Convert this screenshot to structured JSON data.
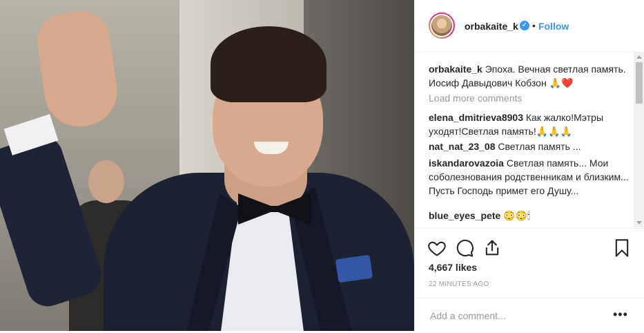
{
  "post": {
    "username": "orbakaite_k",
    "verified_icon": "verified-badge-icon",
    "separator": "•",
    "follow_label": "Follow"
  },
  "caption": {
    "username": "orbakaite_k",
    "text": "Эпоха. Вечная светлая память. Иосиф Давыдович Кобзон 🙏❤️"
  },
  "load_more": "Load more comments",
  "comments": [
    {
      "username": "elena_dmitrieva8903",
      "text": "Как жалко!Мэтры уходят!Светлая память!🙏🙏🙏"
    },
    {
      "username": "nat_nat_23_08",
      "text": "Светлая память ..."
    },
    {
      "username": "iskandarovazoia",
      "text": "Светлая память... Мои соболезнования родственникам и близким... Пусть Господь примет его Душу..."
    },
    {
      "username": "blue_eyes_pete",
      "text": "😳😳🕯"
    }
  ],
  "actions": {
    "like_icon": "heart-icon",
    "comment_icon": "comment-icon",
    "share_icon": "share-icon",
    "save_icon": "bookmark-icon"
  },
  "likes": "4,667 likes",
  "timestamp": "22 MINUTES AGO",
  "add_comment": {
    "placeholder": "Add a comment...",
    "more_label": "•••"
  },
  "colors": {
    "link": "#3897f0",
    "text": "#262626",
    "muted": "#999999"
  }
}
